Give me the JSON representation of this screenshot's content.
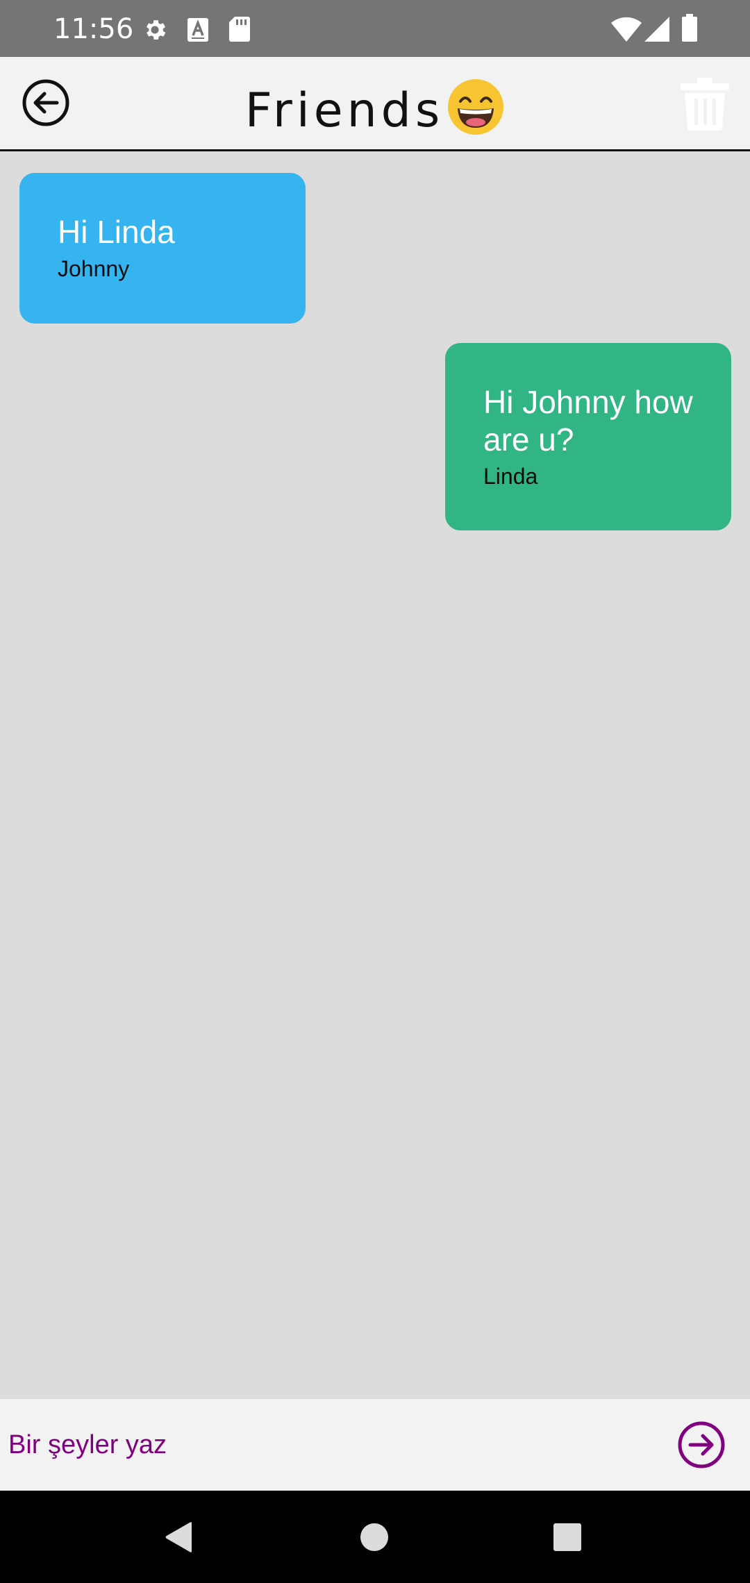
{
  "status_bar": {
    "time": "11:56",
    "icons": [
      "gear-icon",
      "a-box-icon",
      "sd-card-icon",
      "wifi-icon",
      "signal-icon",
      "battery-icon"
    ]
  },
  "header": {
    "title": "Friends",
    "emoji": "grinning-face-emoji",
    "back_icon": "back-arrow-circle-icon",
    "delete_icon": "trash-icon"
  },
  "messages": [
    {
      "text": "Hi Linda",
      "sender": "Johnny",
      "side": "left",
      "color": "#35b4ef"
    },
    {
      "text": "Hi Johnny how are u?",
      "sender": "Linda",
      "side": "right",
      "color": "#32b584"
    }
  ],
  "composer": {
    "placeholder": "Bir şeyler yaz",
    "value": "",
    "send_icon": "send-arrow-circle-icon",
    "accent_color": "#800080"
  },
  "nav_bar": {
    "icons": [
      "back-triangle-icon",
      "home-circle-icon",
      "recents-square-icon"
    ]
  }
}
